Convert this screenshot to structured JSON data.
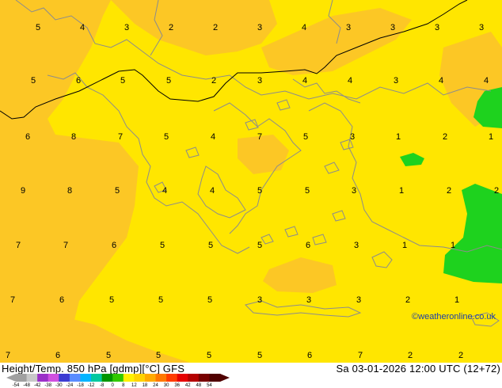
{
  "header": {
    "title": "Height/Temp. 850 hPa [gdmp][°C] GFS",
    "valid_time": "Sa 03-01-2026 12:00 UTC (12+72)",
    "credit": "©weatheronline.co.uk"
  },
  "legend": {
    "labels": [
      "-54",
      "-48",
      "-42",
      "-38",
      "-30",
      "-24",
      "-18",
      "-12",
      "-8",
      "0",
      "8",
      "12",
      "18",
      "24",
      "30",
      "36",
      "42",
      "48",
      "54"
    ],
    "colors": [
      "#a0a0a0",
      "#c8c8c8",
      "#9b30c8",
      "#d050e0",
      "#3c3cd2",
      "#5a8cff",
      "#00b4ff",
      "#00c8a0",
      "#009600",
      "#32c800",
      "#fff000",
      "#ffd200",
      "#ffaa00",
      "#ff7800",
      "#ff3c00",
      "#e60000",
      "#b40000",
      "#780000",
      "#500000"
    ]
  },
  "map": {
    "colors": {
      "yellow": "#ffe600",
      "orange": "#fcc725",
      "green": "#1ed21e",
      "coast": "#8c8c8c",
      "contour": "#000000"
    },
    "temp_labels": [
      "5",
      "4",
      "3",
      "2",
      "2",
      "3",
      "4",
      "3",
      "3",
      "3",
      "3",
      "5",
      "6",
      "5",
      "5",
      "2",
      "3",
      "4",
      "4",
      "3",
      "4",
      "4",
      "6",
      "8",
      "7",
      "5",
      "4",
      "7",
      "5",
      "3",
      "1",
      "2",
      "1",
      "9",
      "8",
      "5",
      "4",
      "4",
      "5",
      "5",
      "3",
      "1",
      "2",
      "2",
      "7",
      "7",
      "6",
      "5",
      "5",
      "5",
      "6",
      "3",
      "1",
      "1",
      "7",
      "6",
      "5",
      "5",
      "5",
      "3",
      "3",
      "3",
      "2",
      "1",
      "7",
      "6",
      "5",
      "5",
      "5",
      "5",
      "6",
      "7",
      "2",
      "2"
    ]
  }
}
